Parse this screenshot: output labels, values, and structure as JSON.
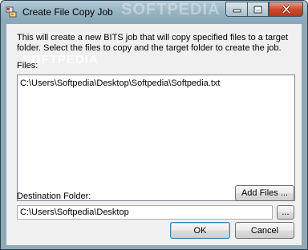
{
  "window": {
    "title": "Create File Copy Job",
    "watermark": "SOFTPEDIA"
  },
  "dialog": {
    "description": "This will create a new BITS job that will copy specified files to a target folder.  Select the files to copy and the target folder to create the job.",
    "watermark": "SOFTPEDIA",
    "files_label": "Files:",
    "files": [
      "C:\\Users\\Softpedia\\Desktop\\Softpedia\\Softpedia.txt"
    ],
    "add_files_label": "Add Files ...",
    "destination_label": "Destination Folder:",
    "destination_value": "C:\\Users\\Softpedia\\Desktop",
    "browse_label": "...",
    "ok_label": "OK",
    "cancel_label": "Cancel"
  },
  "colors": {
    "default_button_border": "#3c7fb1",
    "close_button": "#cf4b2f"
  }
}
